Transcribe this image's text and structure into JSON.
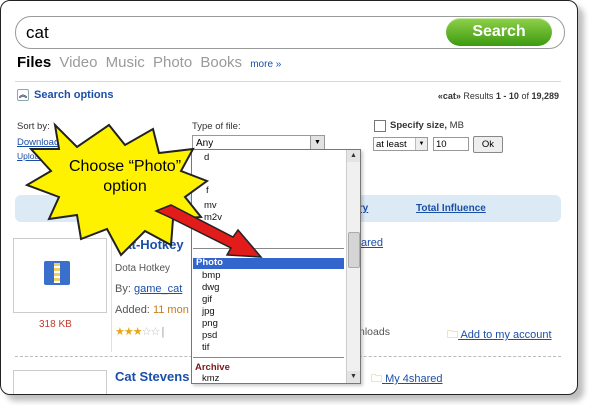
{
  "search": {
    "value": "cat",
    "button": "Search"
  },
  "tabs": {
    "items": [
      "Files",
      "Video",
      "Music",
      "Photo",
      "Books"
    ],
    "more": "more »"
  },
  "options": {
    "link": "Search options",
    "results_prefix": "«cat»",
    "results_text": "Results",
    "results_range": "1 - 10",
    "results_of": "of",
    "results_total": "19,289",
    "sort_by": "Sort by:",
    "sort_downloads": "Downloads",
    "sort_upload": "Upload",
    "type_of_file": "Type of file:",
    "type_selected": "Any",
    "specify_size": "Specify size,",
    "size_unit": "MB",
    "at_least": "at least",
    "size_value": "10",
    "ok": "Ok"
  },
  "sortbar": {
    "item1": "onary",
    "item2": "Total Influence"
  },
  "dropdown": {
    "top_partial": [
      "d",
      "f",
      "mv",
      "m2v",
      "v"
    ],
    "group_photo": "Photo",
    "photo_items": [
      "bmp",
      "dwg",
      "gif",
      "jpg",
      "png",
      "psd",
      "tif"
    ],
    "group_archive": "Archive",
    "archive_items": [
      "kmz"
    ]
  },
  "callout": {
    "line1": "Choose “Photo”",
    "line2": "option"
  },
  "results": [
    {
      "title": "Cat-Hotkey",
      "desc": "Dota Hotkey",
      "by_label": "By:",
      "by_user": "game_cat",
      "added_label": "Added:",
      "added_value": "11 mon",
      "size": "318 KB",
      "rating": 3,
      "downloads_text": "nloads",
      "share_link": "ared",
      "account_link": "Add to my account"
    },
    {
      "title": "Cat Stevens",
      "account_link": "My 4shared"
    }
  ],
  "colors": {
    "accent_green": "#4caf1f",
    "link_blue": "#1a4fa8",
    "selection": "#3366cc",
    "callout_yellow": "#ffee00"
  }
}
